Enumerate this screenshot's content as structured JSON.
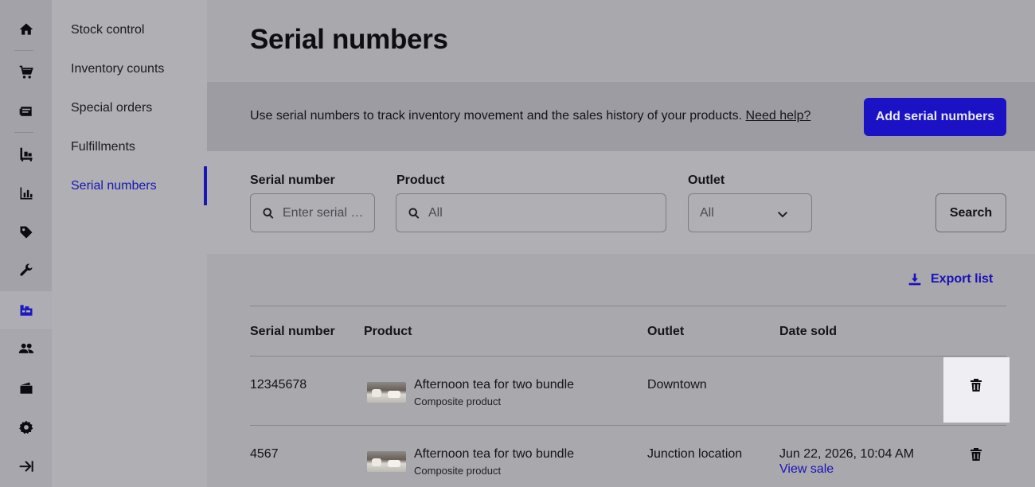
{
  "rail": {
    "icons": [
      "home-icon",
      "cart-icon",
      "catalog-icon",
      "inventory-icon",
      "reports-icon",
      "tag-icon",
      "wrench-icon",
      "serial-numbers-icon",
      "customers-icon",
      "wallet-icon",
      "settings-icon",
      "collapse-icon"
    ],
    "active": "serial-numbers-icon"
  },
  "subnav": {
    "items": [
      "Stock control",
      "Inventory counts",
      "Special orders",
      "Fulfillments",
      "Serial numbers"
    ],
    "active_index": 4
  },
  "page": {
    "title": "Serial numbers"
  },
  "banner": {
    "text": "Use serial numbers to track inventory movement and the sales history of your products.",
    "help_link": "Need help?",
    "add_button": "Add serial numbers"
  },
  "filters": {
    "serial_label": "Serial number",
    "serial_placeholder": "Enter serial …",
    "product_label": "Product",
    "product_value": "All",
    "outlet_label": "Outlet",
    "outlet_value": "All",
    "search_button": "Search"
  },
  "export_label": "Export list",
  "table": {
    "headers": [
      "Serial number",
      "Product",
      "Outlet",
      "Date sold"
    ],
    "rows": [
      {
        "serial": "12345678",
        "product": "Afternoon tea for two bundle",
        "product_type": "Composite product",
        "outlet": "Downtown",
        "date_sold": "",
        "view_sale": ""
      },
      {
        "serial": "4567",
        "product": "Afternoon tea for two bundle",
        "product_type": "Composite product",
        "outlet": "Junction location",
        "date_sold": "Jun 22, 2026, 10:04 AM",
        "view_sale": "View sale"
      }
    ]
  },
  "colors": {
    "accent": "#1a12c4",
    "link": "#1a12b8"
  }
}
